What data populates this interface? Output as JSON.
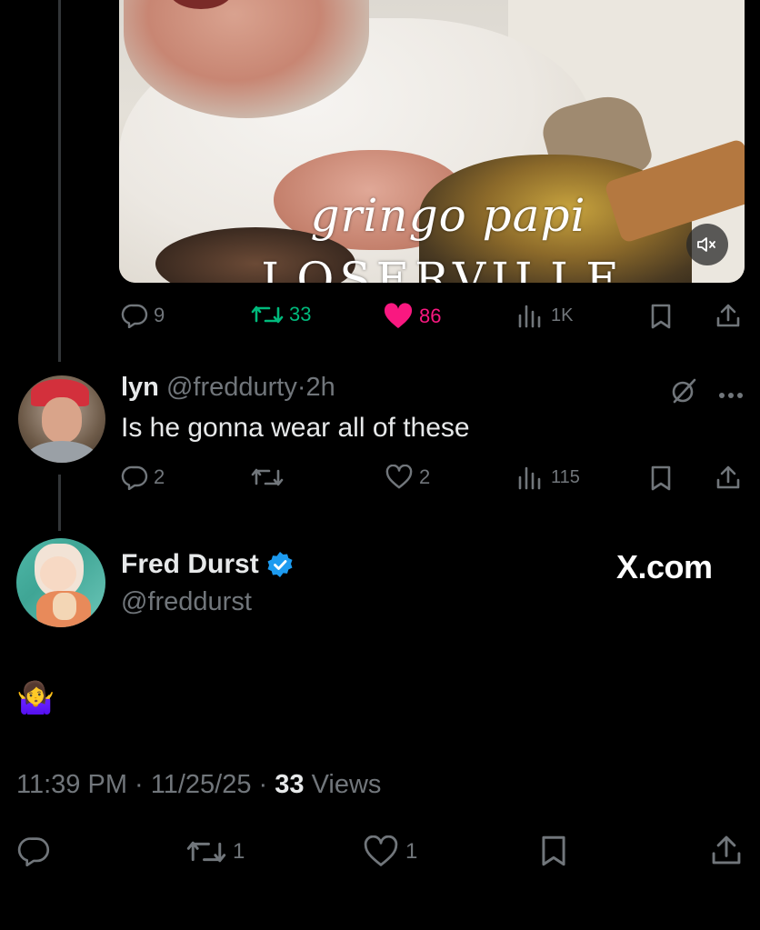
{
  "media": {
    "caption_line1": "gringo papi",
    "caption_line2": "LOSERVILLE",
    "mute_icon": "volume-mute-icon"
  },
  "first_tweet_actions": {
    "replies": "9",
    "retweets": "33",
    "likes": "86",
    "views": "1K",
    "retweet_color": "#00ba7c",
    "like_color": "#f91880"
  },
  "reply": {
    "display_name": "lyn",
    "handle": "@freddurty",
    "separator": "·",
    "time": "2h",
    "text": "Is he gonna wear all of these",
    "replies": "2",
    "retweets": "",
    "likes": "2",
    "views": "115"
  },
  "main_tweet": {
    "display_name": "Fred Durst",
    "handle": "@freddurst",
    "source_logo": "X.com",
    "text": "🤷‍♀️",
    "timestamp": "11:39 PM · 11/25/25 · ",
    "views_count": "33",
    "views_label": " Views",
    "retweets": "1",
    "likes": "1",
    "verified_color": "#1d9bf0"
  },
  "colors": {
    "background": "#000000",
    "text": "#e7e9ea",
    "muted": "#71767b"
  }
}
